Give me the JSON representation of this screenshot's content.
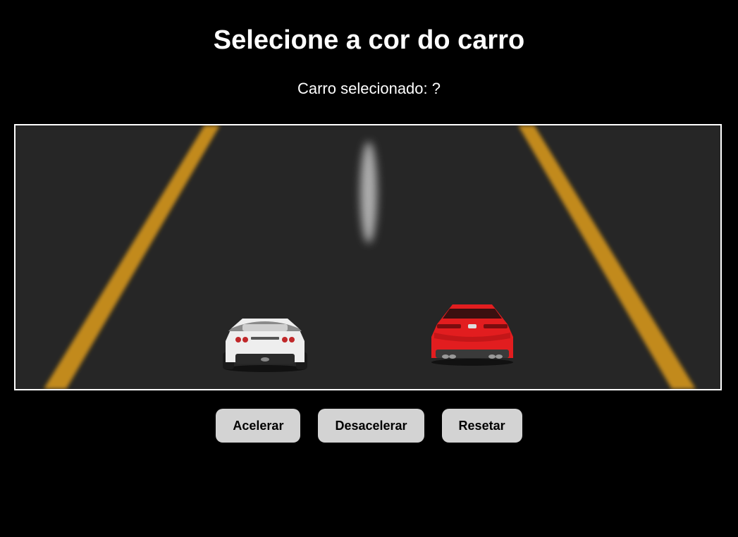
{
  "page": {
    "title": "Selecione a cor do carro",
    "selected_label": "Carro selecionado: ?"
  },
  "cars": [
    {
      "name": "white-car",
      "color": "#eeeeee"
    },
    {
      "name": "red-car",
      "color": "#e21d1f"
    }
  ],
  "colors": {
    "background": "#000000",
    "road": "#262626",
    "lane_yellow": "#c28a1d",
    "center_line": "#cfcfcf",
    "button_bg": "#d3d3d3"
  },
  "controls": {
    "accelerate": "Acelerar",
    "decelerate": "Desacelerar",
    "reset": "Resetar"
  }
}
